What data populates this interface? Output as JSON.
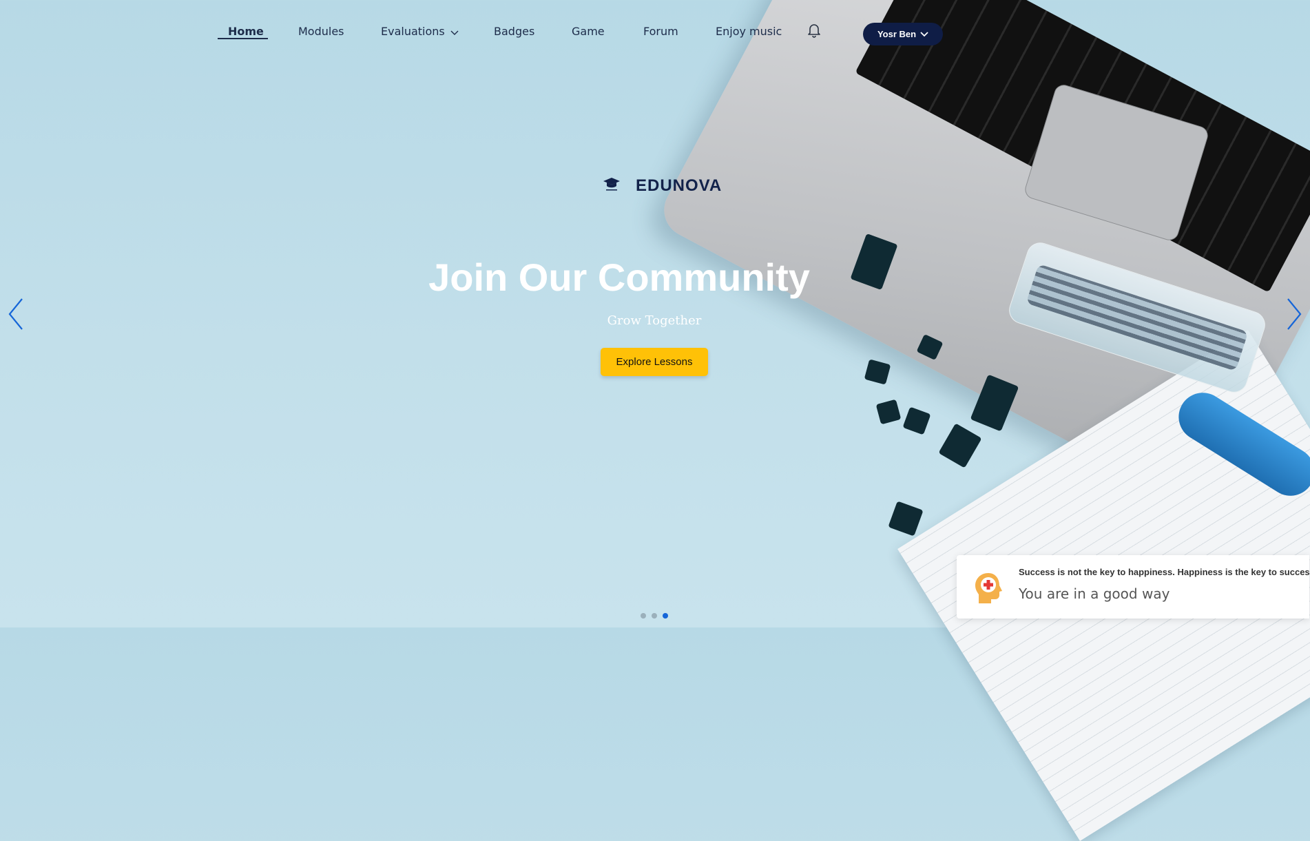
{
  "nav": {
    "items": [
      {
        "label": "Home"
      },
      {
        "label": "Modules"
      },
      {
        "label": "Evaluations"
      },
      {
        "label": "Badges"
      },
      {
        "label": "Game"
      },
      {
        "label": "Forum"
      },
      {
        "label": "Enjoy music"
      }
    ],
    "user_label": "Yosr Ben"
  },
  "brand": {
    "name": "EDUNOVA"
  },
  "hero": {
    "title": "Join Our Community",
    "subtitle": "Grow Together",
    "cta_label": "Explore Lessons"
  },
  "carousel": {
    "slide_count": 3,
    "active_index": 2
  },
  "toast": {
    "title": "Success is not the key to happiness. Happiness is the key to success.",
    "message": "You are in a good way"
  },
  "colors": {
    "accent": "#ffc107",
    "navy": "#0f1d46",
    "arrow": "#1565d8"
  }
}
